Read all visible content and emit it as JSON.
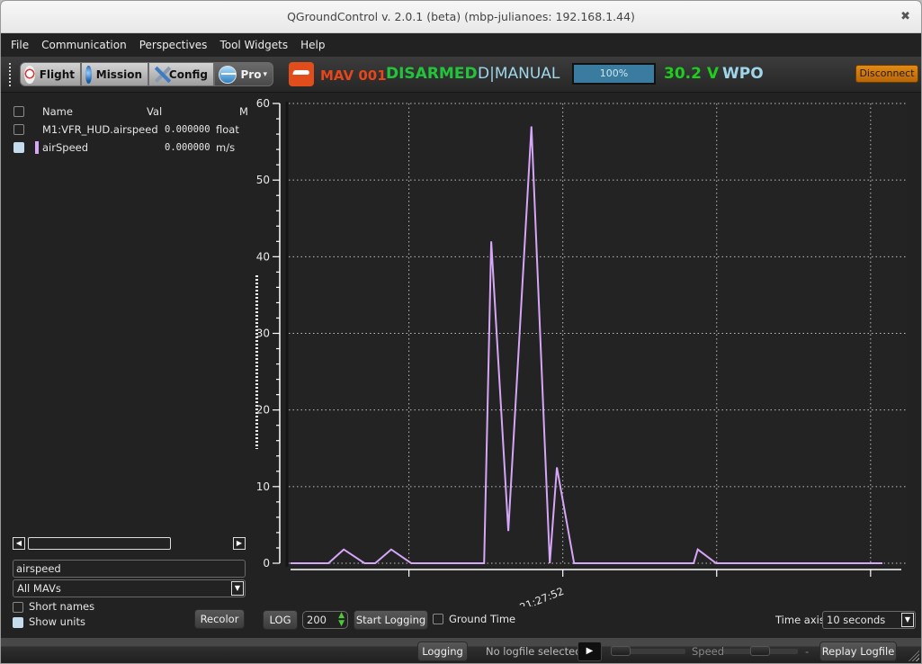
{
  "window": {
    "title": "QGroundControl v. 2.0.1 (beta) (mbp-julianoes: 192.168.1.44)",
    "close_glyph": "✖"
  },
  "menu": [
    "File",
    "Communication",
    "Perspectives",
    "Tool Widgets",
    "Help"
  ],
  "toolbar": {
    "perspectives": [
      {
        "label": "Flight",
        "icon": "shield-icon"
      },
      {
        "label": "Mission",
        "icon": "globe-icon"
      },
      {
        "label": "Config",
        "icon": "tools-icon"
      },
      {
        "label": "Pro",
        "icon": "monitor-icon",
        "dropdown": "▾"
      }
    ],
    "mav_name": "MAV 001",
    "arm_state": "DISARMED",
    "flight_mode": "D|MANUAL",
    "battery_percent_label": "100%",
    "battery_percent": 100,
    "voltage": "30.2 V",
    "waypoint": "WPO",
    "disconnect_label": "Disconnect",
    "colors": {
      "mav": "#e4471b",
      "armed": "#23c33b",
      "mode": "#9fd6ea",
      "voltage": "#1ecd1e",
      "battery": "#3a7ca0",
      "disconnect": "#d07a0e"
    }
  },
  "sidebar": {
    "columns": {
      "name": "Name",
      "value": "Val",
      "unit": "M"
    },
    "rows": [
      {
        "checked": false,
        "name": "M1:VFR_HUD.airspeed",
        "value": "0.000000",
        "unit": "float",
        "color": null
      },
      {
        "checked": true,
        "name": "airSpeed",
        "value": "0.000000",
        "unit": "m/s",
        "color": "#d6a6f8"
      }
    ],
    "scroll_left": "◀",
    "scroll_right": "▶",
    "filter_value": "airspeed",
    "mav_filter": "All MAVs",
    "short_names_label": "Short names",
    "short_names_checked": false,
    "show_units_label": "Show units",
    "show_units_checked": true,
    "recolor_label": "Recolor"
  },
  "plot_controls": {
    "log_label": "LOG",
    "log_count": "200",
    "start_logging_label": "Start Logging",
    "ground_time_label": "Ground Time",
    "ground_time_checked": false,
    "time_axis_label": "Time axis:",
    "time_axis_value": "10 seconds"
  },
  "statusbar": {
    "logging_label": "Logging",
    "logfile_text": "No logfile selected..",
    "play_glyph": "▶",
    "speed_label": "Speed",
    "dash": "-",
    "replay_label": "Replay Logfile"
  },
  "chart_data": {
    "type": "line",
    "title": "",
    "xlabel": "",
    "ylabel": "",
    "ylim": [
      0,
      60
    ],
    "xlim": [
      0,
      10
    ],
    "x_units": "seconds (10 second window)",
    "yticks": [
      0,
      10,
      20,
      30,
      40,
      50,
      60
    ],
    "y_minor_step": 2,
    "xtick_positions": [
      2.0,
      4.6,
      7.2,
      9.8
    ],
    "xtick_labels": [
      "",
      "21:27:52",
      "",
      ""
    ],
    "grid": true,
    "series": [
      {
        "name": "airSpeed",
        "color": "#d6a6f8",
        "x": [
          0,
          0.64,
          0.9,
          1.25,
          1.43,
          1.7,
          2.04,
          3.27,
          3.39,
          3.68,
          4.07,
          4.38,
          4.5,
          4.79,
          6.81,
          6.88,
          7.19,
          10.0
        ],
        "y": [
          0,
          0,
          1.8,
          0,
          0,
          1.8,
          0,
          0,
          42,
          4.2,
          57,
          0,
          12.5,
          0,
          0,
          1.8,
          0,
          0
        ]
      }
    ]
  }
}
